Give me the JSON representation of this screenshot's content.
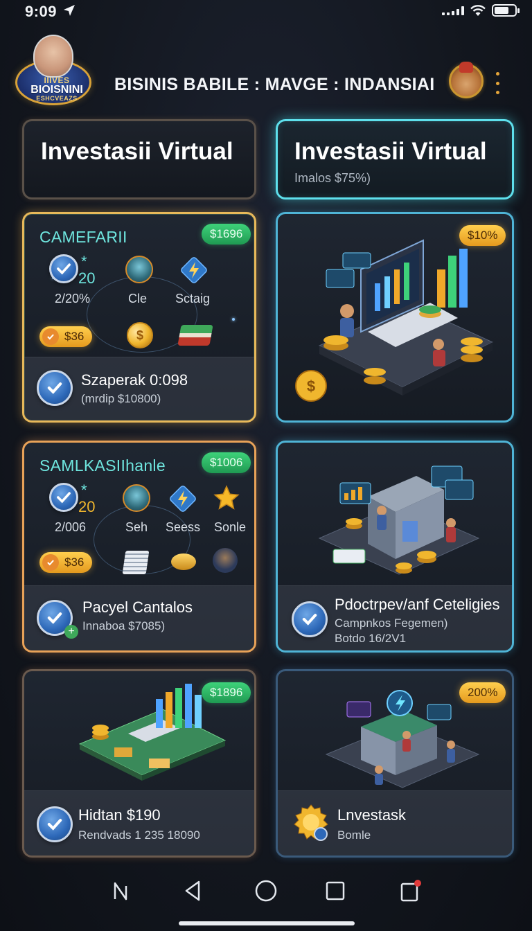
{
  "status": {
    "time": "9:09"
  },
  "header": {
    "title": "BISINIS BABILE : MAVGE : INDANSIAI",
    "logo": {
      "line1": "IIIVES",
      "line2": "BIOISNINI",
      "line3": "ESHCVEAZS"
    }
  },
  "tabs": [
    {
      "label": "Investasii Virtual",
      "sub": ""
    },
    {
      "label": "Investasii Virtual",
      "sub": "Imalos $75%)"
    }
  ],
  "cards": [
    {
      "title": "CAMEFARII",
      "badge": "$1696",
      "stats": [
        {
          "value": "20",
          "label": "2/20%"
        },
        {
          "label": "Cle"
        },
        {
          "label": "Sctaig"
        }
      ],
      "price": "$36",
      "footer_title": "Szaperak 0:098",
      "footer_sub": "(mrdip $10800)"
    },
    {
      "badge": "$10%"
    },
    {
      "title": "SAMLKASIIhanle",
      "badge": "$1006",
      "stats": [
        {
          "value": "20",
          "label": "2/006"
        },
        {
          "label": "Seh"
        },
        {
          "label": "Seess"
        },
        {
          "label": "Sonle"
        }
      ],
      "price": "$36",
      "footer_title": "Pacyel Cantalos",
      "footer_sub": "Innaboa $7085)"
    },
    {
      "footer_title": "Pdoctrpev/anf Ceteligies",
      "footer_sub": "Campnkos Fegemen)",
      "footer_sub2": "Botdo 16/2V1"
    },
    {
      "badge": "$1896",
      "footer_title": "Hidtan $190",
      "footer_sub": "Rendvads 1 235 18090"
    },
    {
      "badge": "200%",
      "footer_title": "Lnvestask",
      "footer_sub": "Bomle"
    }
  ],
  "icons": {
    "status": [
      "location-arrow-icon",
      "signal-icon",
      "wifi-icon",
      "battery-icon"
    ],
    "nav": [
      "back-gesture-icon",
      "back-icon",
      "home-icon",
      "recents-icon",
      "notification-icon"
    ]
  },
  "colors": {
    "accent_cyan": "#5ee0ec",
    "accent_green": "#3ed27a",
    "accent_orange": "#f0a82a"
  }
}
